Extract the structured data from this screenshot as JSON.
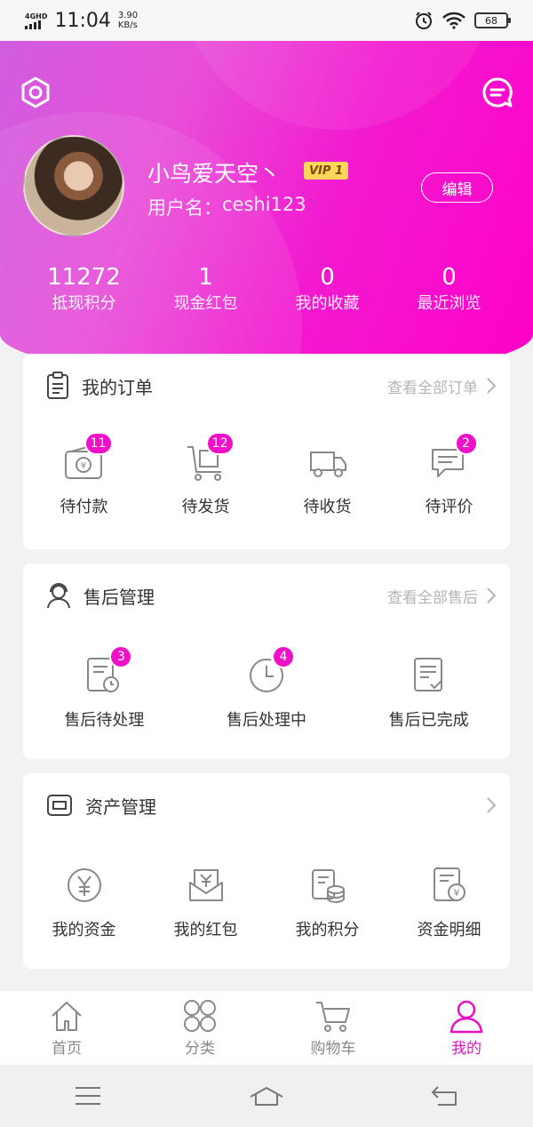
{
  "status_bar": {
    "network": "4GHD",
    "time": "11:04",
    "speed_value": "3.90",
    "speed_unit": "KB/s",
    "battery": "68"
  },
  "profile": {
    "nickname": "小鸟爱天空丶",
    "vip": "VIP 1",
    "username_label": "用户名：",
    "username": "ceshi123",
    "edit_label": "编辑",
    "stats": [
      {
        "value": "11272",
        "label": "抵现积分"
      },
      {
        "value": "1",
        "label": "现金红包"
      },
      {
        "value": "0",
        "label": "我的收藏"
      },
      {
        "value": "0",
        "label": "最近浏览"
      }
    ]
  },
  "orders": {
    "title": "我的订单",
    "more": "查看全部订单",
    "items": [
      {
        "label": "待付款",
        "badge": "11",
        "icon": "wallet-yen-icon"
      },
      {
        "label": "待发货",
        "badge": "12",
        "icon": "cart-box-icon"
      },
      {
        "label": "待收货",
        "badge": "",
        "icon": "truck-icon"
      },
      {
        "label": "待评价",
        "badge": "2",
        "icon": "comment-icon"
      }
    ]
  },
  "aftersale": {
    "title": "售后管理",
    "more": "查看全部售后",
    "items": [
      {
        "label": "售后待处理",
        "badge": "3",
        "icon": "document-clock-icon"
      },
      {
        "label": "售后处理中",
        "badge": "4",
        "icon": "clock-icon"
      },
      {
        "label": "售后已完成",
        "badge": "",
        "icon": "document-check-icon"
      }
    ]
  },
  "assets": {
    "title": "资产管理",
    "items": [
      {
        "label": "我的资金",
        "icon": "yen-circle-icon"
      },
      {
        "label": "我的红包",
        "icon": "red-envelope-icon"
      },
      {
        "label": "我的积分",
        "icon": "coins-icon"
      },
      {
        "label": "资金明细",
        "icon": "bill-detail-icon"
      }
    ]
  },
  "tabbar": [
    {
      "label": "首页",
      "icon": "home-icon",
      "active": false
    },
    {
      "label": "分类",
      "icon": "grid-icon",
      "active": false
    },
    {
      "label": "购物车",
      "icon": "cart-icon",
      "active": false
    },
    {
      "label": "我的",
      "icon": "user-icon",
      "active": true
    }
  ],
  "colors": {
    "accent": "#e80fc4",
    "badge": "#f010c8",
    "hero_start": "#d05ce0",
    "hero_end": "#ff00c8",
    "vip_gold": "#fdd65a"
  }
}
